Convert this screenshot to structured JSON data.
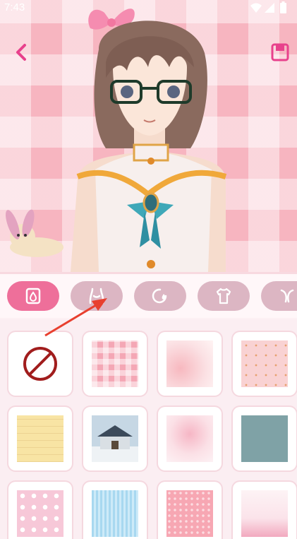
{
  "status_bar": {
    "time": "7:43",
    "icons": [
      "wifi-icon",
      "signal-icon",
      "battery-icon"
    ]
  },
  "header": {
    "back_icon": "chevron-left-icon",
    "save_icon": "save-icon"
  },
  "tabs": [
    {
      "name": "background",
      "icon": "background-icon",
      "active": true
    },
    {
      "name": "body",
      "icon": "body-icon",
      "active": false
    },
    {
      "name": "skin",
      "icon": "skin-icon",
      "active": false
    },
    {
      "name": "top",
      "icon": "shirt-icon",
      "active": false
    },
    {
      "name": "more",
      "icon": "bow-icon",
      "active": false
    }
  ],
  "backgrounds": [
    {
      "id": "none",
      "kind": "none-icon"
    },
    {
      "id": "pink-plaid"
    },
    {
      "id": "pink-watercolor"
    },
    {
      "id": "pink-dots"
    },
    {
      "id": "yellow-paper"
    },
    {
      "id": "snowy-house"
    },
    {
      "id": "pink-sakura"
    },
    {
      "id": "blue-texture"
    },
    {
      "id": "bunny-pattern"
    },
    {
      "id": "blue-stripes"
    },
    {
      "id": "pink-pattern"
    },
    {
      "id": "pink-flowers"
    }
  ],
  "colors": {
    "accent": "#ee6f9a",
    "tab_inactive": "#dcb6c3",
    "preview_bg": "#f7b5c0",
    "annotation_arrow": "#e8402f"
  }
}
